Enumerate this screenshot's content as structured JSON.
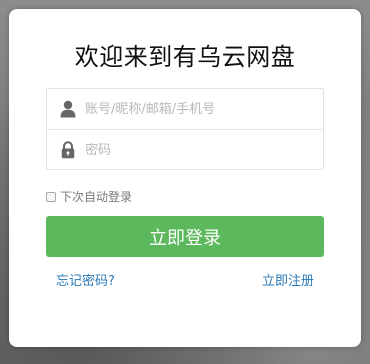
{
  "login": {
    "title": "欢迎来到有乌云网盘",
    "account_placeholder": "账号/昵称/邮箱/手机号",
    "password_placeholder": "密码",
    "remember_label": "下次自动登录",
    "remember_checked": false,
    "submit_label": "立即登录",
    "forgot_label": "忘记密码?",
    "register_label": "立即注册"
  },
  "icons": {
    "account": "user-icon",
    "password": "lock-icon"
  },
  "colors": {
    "primary_button": "#5cb85c",
    "link": "#2a7ab8",
    "icon": "#666666"
  }
}
